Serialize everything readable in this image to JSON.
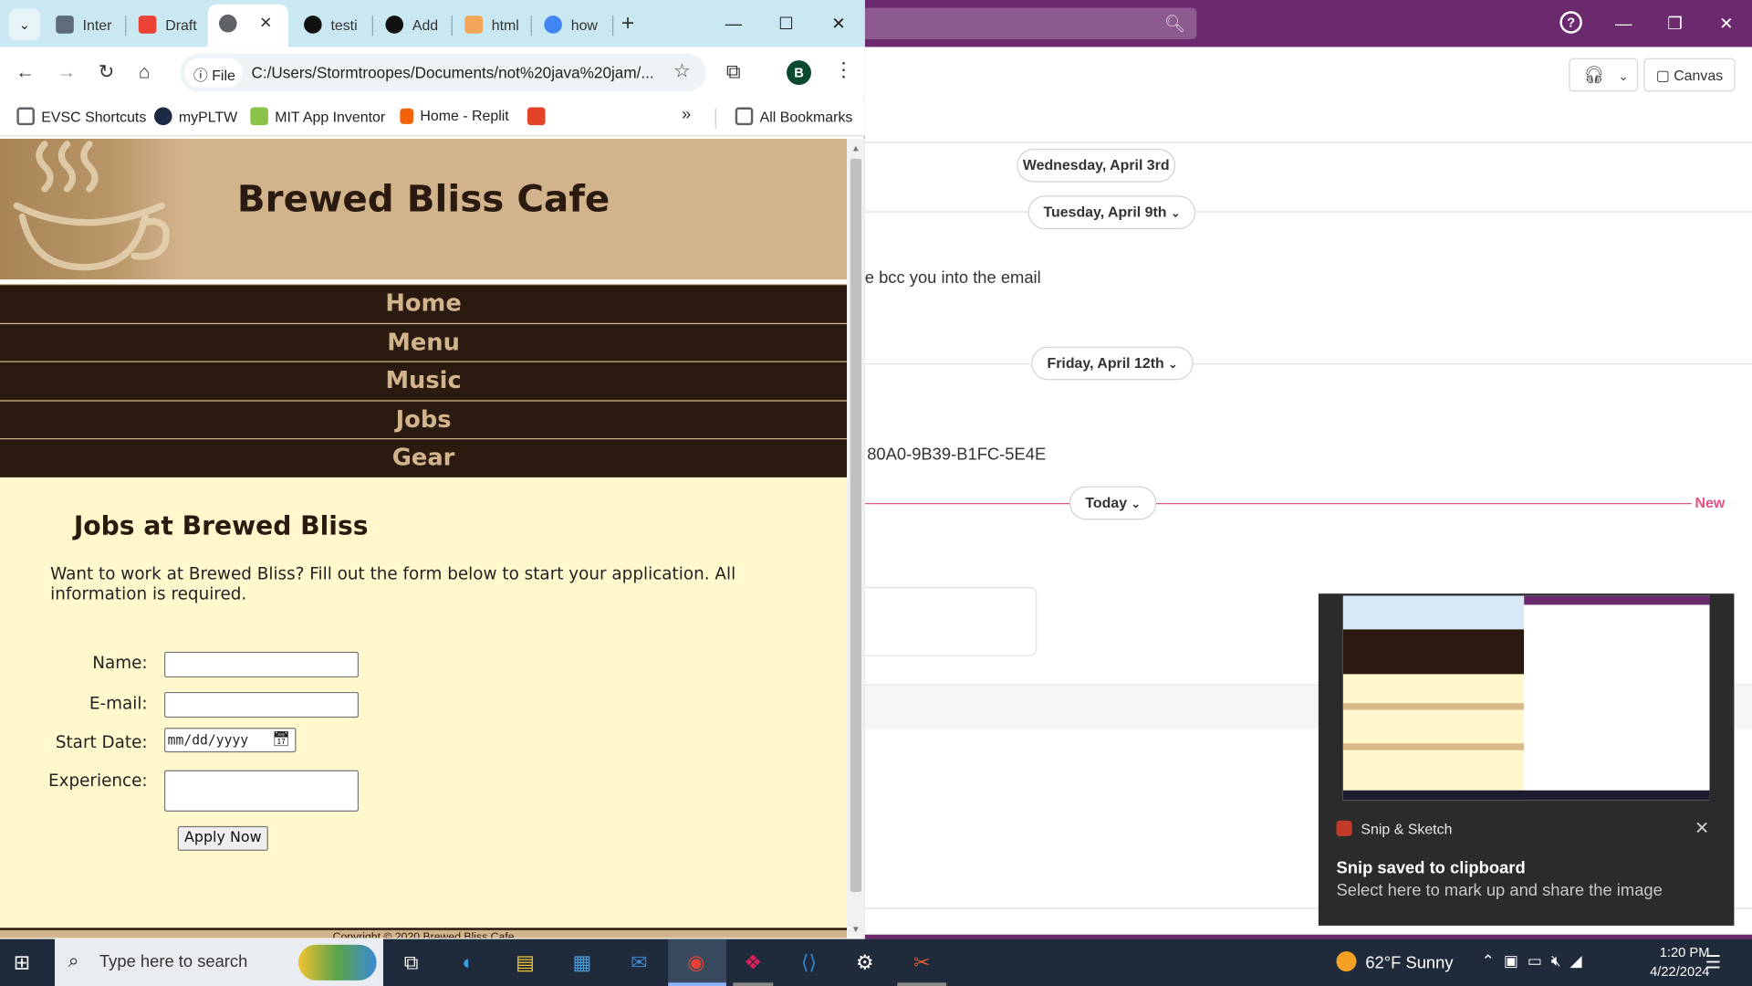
{
  "chrome": {
    "tabs": [
      {
        "label": "Inter",
        "favicon_color": "#5f6b7a"
      },
      {
        "label": "Draft",
        "favicon_color": "#ea4335"
      },
      {
        "label": "",
        "favicon_color": "#5f6368"
      },
      {
        "label": "testi",
        "favicon_color": "#111111"
      },
      {
        "label": "Add",
        "favicon_color": "#111111"
      },
      {
        "label": "html",
        "favicon_color": "#f2a65a"
      },
      {
        "label": "how",
        "favicon_color": "#4285f4"
      }
    ],
    "active_tab_index": 2,
    "active_tab_close": "✕",
    "new_tab": "+",
    "file_chip": "File",
    "url": "C:/Users/Stormtroopes/Documents/not%20java%20jam/...",
    "profile_initial": "B",
    "bookmarks": [
      {
        "label": "EVSC Shortcuts",
        "color": "#5f6368"
      },
      {
        "label": "myPLTW",
        "color": "#1e2a44"
      },
      {
        "label": "MIT App Inventor",
        "color": "#8bc34a"
      },
      {
        "label": "Home - Replit",
        "color": "#f26207"
      },
      {
        "label": "",
        "color": "#e24329"
      }
    ],
    "bookmarks_more": "»",
    "all_bookmarks": "All Bookmarks"
  },
  "site": {
    "title": "Brewed Bliss Cafe",
    "nav": [
      "Home",
      "Menu",
      "Music",
      "Jobs",
      "Gear"
    ],
    "jobs_heading": "Jobs at Brewed Bliss",
    "jobs_intro": "Want to work at Brewed Bliss? Fill out the form below to start your application. All information is required.",
    "form": {
      "name_label": "Name:",
      "email_label": "E-mail:",
      "start_date_label": "Start Date:",
      "start_date_placeholder": "mm/dd/yyyy",
      "experience_label": "Experience:",
      "apply_button": "Apply Now"
    },
    "footer": "Copyright © 2020 Brewed Bliss Cafe"
  },
  "teams": {
    "canvas_label": "Canvas",
    "dates": [
      "Wednesday, April 3rd",
      "Tuesday, April 9th",
      "Friday, April 12th",
      "Today"
    ],
    "message_1": "e bcc you into the email",
    "message_2": "80A0-9B39-B1FC-5E4E",
    "new_label": "New"
  },
  "toast": {
    "app_name": "Snip & Sketch",
    "title": "Snip saved to clipboard",
    "body": "Select here to mark up and share the image",
    "close": "✕"
  },
  "taskbar": {
    "search_placeholder": "Type here to search",
    "weather_temp": "62°F",
    "weather_cond": "Sunny",
    "time": "1:20 PM",
    "date": "4/22/2024"
  }
}
